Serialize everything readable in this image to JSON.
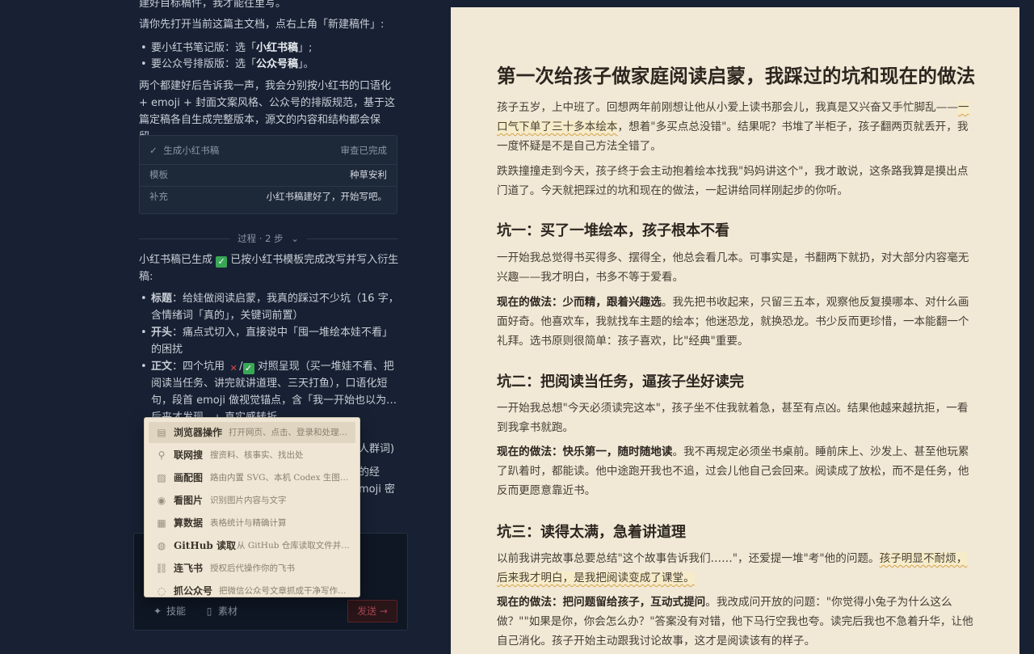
{
  "chat": {
    "line_top": "建好目标稿件，我才能往里写。",
    "intro": "请你先打开当前这篇主文档，点右上角「新建稿件」:",
    "choices": [
      {
        "pre": "要小红书笔记版：选「",
        "bold": "小红书稿",
        "post": "」;"
      },
      {
        "pre": "要公众号排版版：选「",
        "bold": "公众号稿",
        "post": "」。"
      }
    ],
    "outro": "两个都建好后告诉我一声，我会分别按小红书的口语化 + emoji + 封面文案风格、公众号的排版规范，基于这篇定稿各自生成完整版本，源文的内容和结构都会保留。",
    "status_card": {
      "title": "生成小红书稿",
      "state": "审查已完成",
      "rows": [
        {
          "label": "模板",
          "value": "种草安利"
        },
        {
          "label": "补充",
          "value": "小红书稿建好了，开始写吧。"
        }
      ]
    },
    "process_label": "过程 · 2 步",
    "result_pre": "小红书稿已生成",
    "result_post": "已按小红书模板完成改写并写入衍生稿:",
    "result_items": [
      {
        "bold": "标题",
        "text": "：给娃做阅读启蒙，我真的踩过不少坑（16 字，含情绪词「真的」，关键词前置）"
      },
      {
        "bold": "开头",
        "text": "：痛点式切入，直接说中「囤一堆绘本娃不看」的困扰"
      },
      {
        "bold": "正文",
        "text_a": "：四个坑用",
        "text_b": "对照呈现（买一堆娃不看、把阅读当任务、讲完就讲道理、三天打鱼），口语化短句，段首 emoji 做视觉锚点，含「我一开始也以为…后来才发现…」真实感转折"
      }
    ],
    "hidden_fragments": {
      "a": "人群词)",
      "b": "的经",
      "c": "moji 密"
    },
    "composer": {
      "skills_label": "技能",
      "material_label": "素材",
      "send_label": "发送 →"
    }
  },
  "menu": {
    "items": [
      {
        "icon": "browser-icon",
        "glyph": "▤",
        "name": "浏览器操作",
        "desc": "打开网页、点击、登录和处理交互"
      },
      {
        "icon": "search-icon",
        "glyph": "⚲",
        "name": "联网搜",
        "desc": "搜资料、核事实、找出处"
      },
      {
        "icon": "image-icon",
        "glyph": "▨",
        "name": "画配图",
        "desc": "路由内置 SVG、本机 Codex 生图与…"
      },
      {
        "icon": "eye-icon",
        "glyph": "◉",
        "name": "看图片",
        "desc": "识别图片内容与文字"
      },
      {
        "icon": "table-icon",
        "glyph": "▦",
        "name": "算数据",
        "desc": "表格统计与精确计算"
      },
      {
        "icon": "github-icon",
        "glyph": "◍",
        "name": "GitHub 读取",
        "desc": "从 GitHub 仓库读取文件并…"
      },
      {
        "icon": "link-icon",
        "glyph": "⛓",
        "name": "连飞书",
        "desc": "授权后代操作你的飞书"
      },
      {
        "icon": "wechat-icon",
        "glyph": "◌",
        "name": "抓公众号",
        "desc": "把微信公众号文章抓成干净写作素材"
      }
    ]
  },
  "doc": {
    "title": "第一次给孩子做家庭阅读启蒙，我踩过的坑和现在的做法",
    "p1_a": "孩子五岁，上中班了。回想两年前刚想让他从小爱上读书那会儿，我真是又兴奋又手忙脚乱——",
    "p1_hl": "一口气下单了三十多本绘本",
    "p1_b": "，想着\"多买点总没错\"。结果呢？书堆了半柜子，孩子翻两页就丢开，我一度怀疑是不是自己方法全错了。",
    "p2": "跌跌撞撞走到今天，孩子终于会主动抱着绘本找我\"妈妈讲这个\"，我才敢说，这条路我算是摸出点门道了。今天就把踩过的坑和现在的做法，一起讲给同样刚起步的你听。",
    "h_pit1": "坑一：买了一堆绘本，孩子根本不看",
    "pit1_p": "一开始我总觉得书买得多、摆得全，他总会看几本。可事实是，书翻两下就扔，对大部分内容毫无兴趣——我才明白，书多不等于爱看。",
    "pit1_now_b": "现在的做法：少而精，跟着兴趣选",
    "pit1_now": "。我先把书收起来，只留三五本，观察他反复摸哪本、对什么画面好奇。他喜欢车，我就找车主题的绘本；他迷恐龙，就换恐龙。书少反而更珍惜，一本能翻一个礼拜。选书原则很简单：孩子喜欢，比\"经典\"重要。",
    "h_pit2": "坑二：把阅读当任务，逼孩子坐好读完",
    "pit2_p": "一开始我总想\"今天必须读完这本\"，孩子坐不住我就着急，甚至有点凶。结果他越来越抗拒，一看到我拿书就跑。",
    "pit2_now_b": "现在的做法：快乐第一，随时随地读",
    "pit2_now": "。我不再规定必须坐书桌前。睡前床上、沙发上、甚至他玩累了趴着时，都能读。他中途跑开我也不追，过会儿他自己会回来。阅读成了放松，而不是任务，他反而更愿意靠近书。",
    "h_pit3": "坑三：读得太满，急着讲道理",
    "pit3_a": "以前我讲完故事总要总结\"这个故事告诉我们……\"，还爱提一堆\"考\"他的问题。",
    "pit3_hl": "孩子明显不耐烦，后来我才明白，是我把阅读变成了课堂。",
    "pit3_now_b": "现在的做法：把问题留给孩子，互动式提问",
    "pit3_now": "。我改成问开放的问题：\"你觉得小兔子为什么这么做？\"\"如果是你，你会怎么办？\"答案没有对错，他下马行空我也夸。读完后我也不急着升华，让他自己消化。孩子开始主动跟我讨论故事，这才是阅读该有的样子。"
  }
}
